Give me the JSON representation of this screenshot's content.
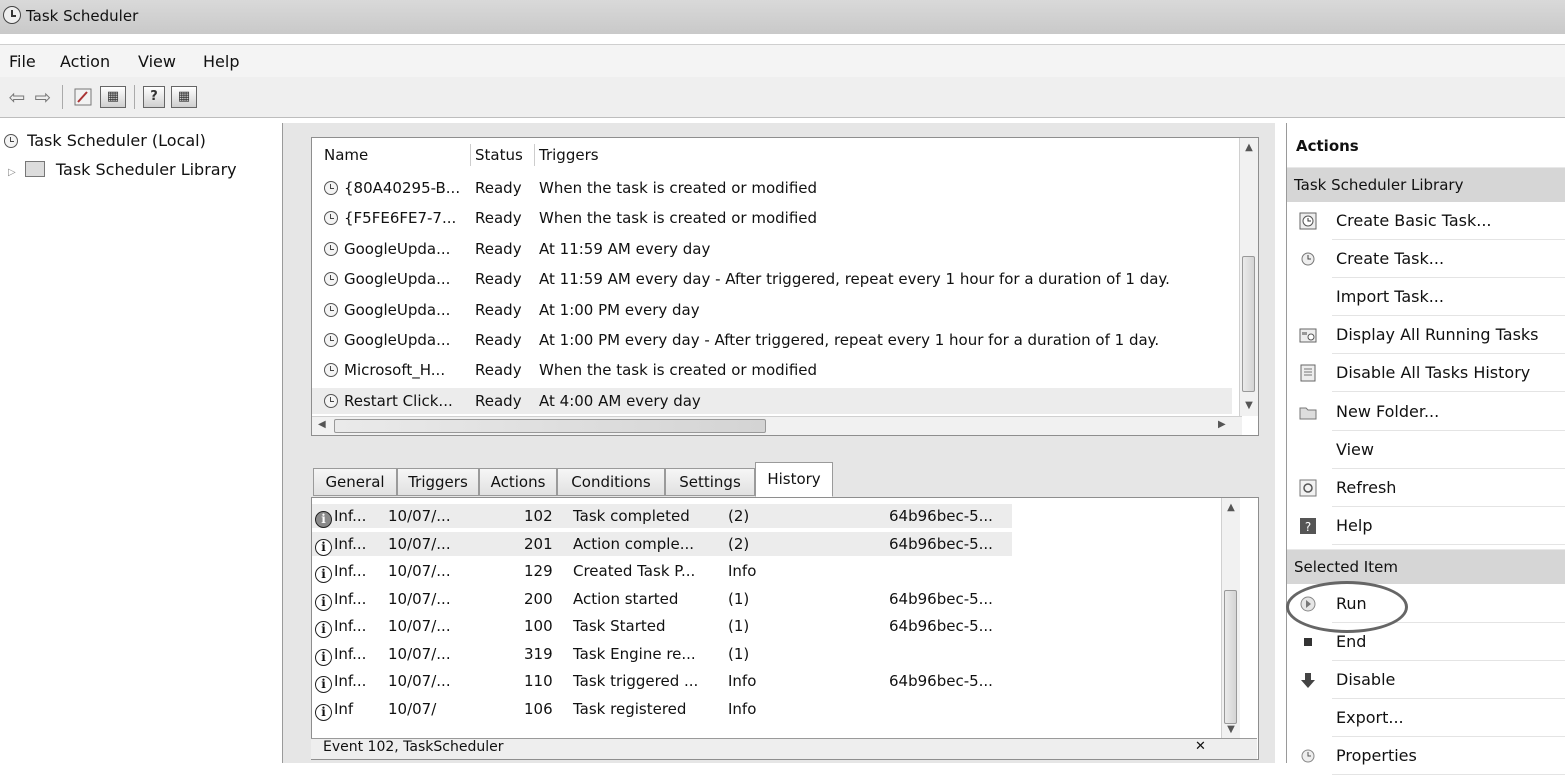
{
  "window": {
    "title": "Task Scheduler"
  },
  "menu": [
    "File",
    "Action",
    "View",
    "Help"
  ],
  "toolbar": {
    "icons": [
      "back-arrow-icon",
      "forward-arrow-icon",
      "properties-icon",
      "show-console-tree-icon",
      "help-icon",
      "show-action-pane-icon"
    ],
    "help_glyph": "?"
  },
  "tree": {
    "root": "Task Scheduler (Local)",
    "child": "Task Scheduler Library"
  },
  "tasks": {
    "headers": [
      "Name",
      "Status",
      "Triggers"
    ],
    "rows": [
      {
        "name": "{80A40295-B...",
        "status": "Ready",
        "trigger": "When the task is created or modified"
      },
      {
        "name": "{F5FE6FE7-7...",
        "status": "Ready",
        "trigger": "When the task is created or modified"
      },
      {
        "name": "GoogleUpda...",
        "status": "Ready",
        "trigger": "At 11:59 AM every day"
      },
      {
        "name": "GoogleUpda...",
        "status": "Ready",
        "trigger": "At 11:59 AM every day - After triggered, repeat every 1 hour for a duration of 1 day."
      },
      {
        "name": "GoogleUpda...",
        "status": "Ready",
        "trigger": "At 1:00 PM every day"
      },
      {
        "name": "GoogleUpda...",
        "status": "Ready",
        "trigger": "At 1:00 PM every day - After triggered, repeat every 1 hour for a duration of 1 day."
      },
      {
        "name": "Microsoft_H...",
        "status": "Ready",
        "trigger": "When the task is created or modified"
      },
      {
        "name": "Restart Click...",
        "status": "Ready",
        "trigger": "At 4:00 AM every day"
      }
    ],
    "selected_index": 7
  },
  "tabs": {
    "items": [
      "General",
      "Triggers",
      "Actions",
      "Conditions",
      "Settings",
      "History"
    ],
    "active": "History"
  },
  "history": {
    "rows": [
      {
        "level": "Inf...",
        "date": "10/07/...",
        "event_id": "102",
        "category": "Task completed",
        "op": "(2)",
        "correlation": "64b96bec-5..."
      },
      {
        "level": "Inf...",
        "date": "10/07/...",
        "event_id": "201",
        "category": "Action comple...",
        "op": "(2)",
        "correlation": "64b96bec-5..."
      },
      {
        "level": "Inf...",
        "date": "10/07/...",
        "event_id": "129",
        "category": "Created Task P...",
        "op": "Info",
        "correlation": ""
      },
      {
        "level": "Inf...",
        "date": "10/07/...",
        "event_id": "200",
        "category": "Action started",
        "op": "(1)",
        "correlation": "64b96bec-5..."
      },
      {
        "level": "Inf...",
        "date": "10/07/...",
        "event_id": "100",
        "category": "Task Started",
        "op": "(1)",
        "correlation": "64b96bec-5..."
      },
      {
        "level": "Inf...",
        "date": "10/07/...",
        "event_id": "319",
        "category": "Task Engine re...",
        "op": "(1)",
        "correlation": ""
      },
      {
        "level": "Inf...",
        "date": "10/07/...",
        "event_id": "110",
        "category": "Task triggered ...",
        "op": "Info",
        "correlation": "64b96bec-5..."
      },
      {
        "level": "Inf",
        "date": "10/07/",
        "event_id": "106",
        "category": "Task registered",
        "op": "Info",
        "correlation": ""
      }
    ],
    "footer": "Event 102, TaskScheduler"
  },
  "actions_pane": {
    "title": "Actions",
    "section1": "Task Scheduler Library",
    "items1": [
      {
        "label": "Create Basic Task...",
        "icon": "create-basic-task-icon"
      },
      {
        "label": "Create Task...",
        "icon": "create-task-icon"
      },
      {
        "label": "Import Task...",
        "icon": ""
      },
      {
        "label": "Display All Running Tasks",
        "icon": "running-tasks-icon"
      },
      {
        "label": "Disable All Tasks History",
        "icon": "disable-history-icon"
      },
      {
        "label": "New Folder...",
        "icon": "new-folder-icon"
      },
      {
        "label": "View",
        "icon": ""
      },
      {
        "label": "Refresh",
        "icon": "refresh-icon"
      },
      {
        "label": "Help",
        "icon": "help-icon"
      }
    ],
    "section2": "Selected Item",
    "items2": [
      {
        "label": "Run",
        "icon": "run-icon"
      },
      {
        "label": "End",
        "icon": "end-icon"
      },
      {
        "label": "Disable",
        "icon": "disable-icon"
      },
      {
        "label": "Export...",
        "icon": ""
      },
      {
        "label": "Properties",
        "icon": "properties-icon"
      }
    ]
  }
}
